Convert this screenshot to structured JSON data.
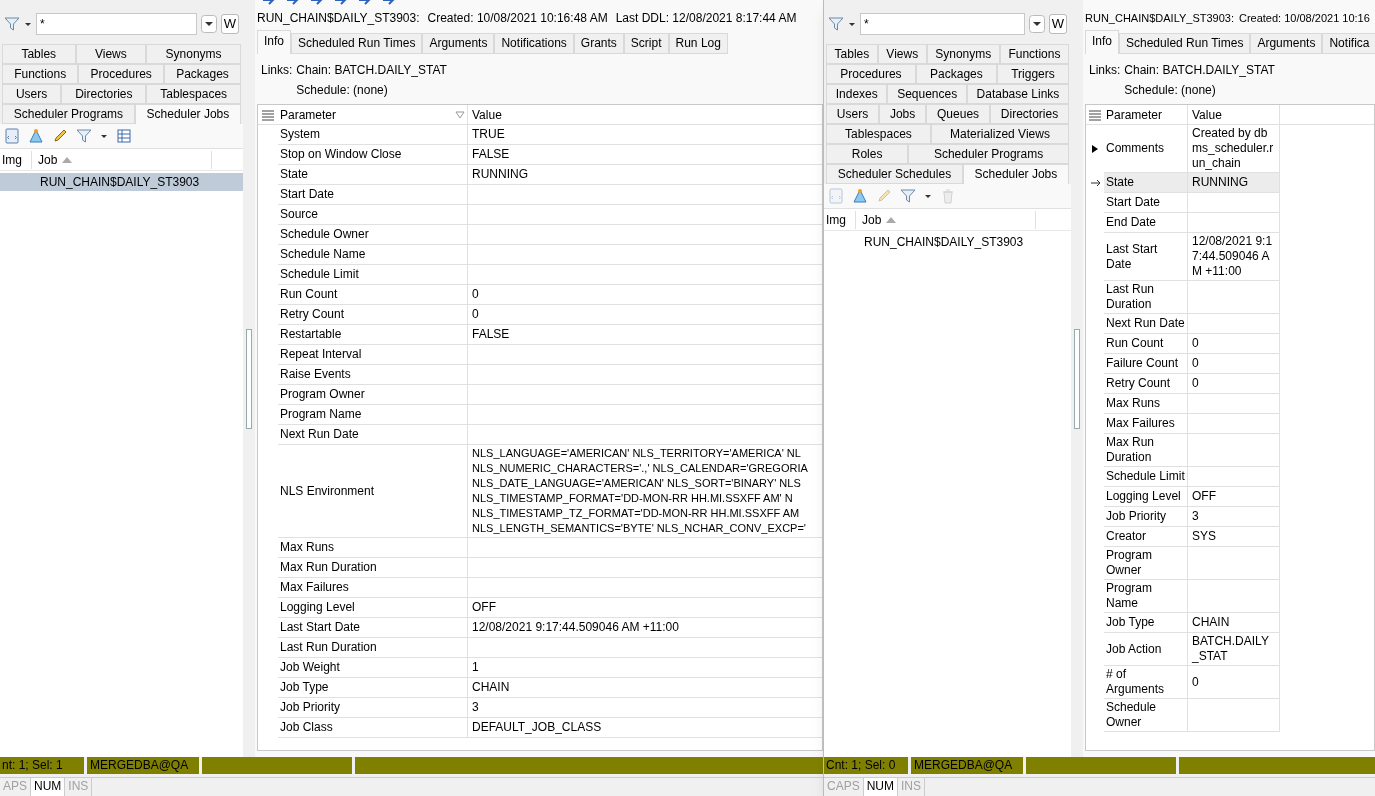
{
  "windows": [
    {
      "explorer": {
        "filter_value": "*",
        "w_button": "W",
        "tab_rows": [
          [
            {
              "label": "Tables",
              "selected": false
            },
            {
              "label": "Views",
              "selected": false
            },
            {
              "label": "Synonyms",
              "selected": false
            }
          ],
          [
            {
              "label": "Functions",
              "selected": false
            },
            {
              "label": "Procedures",
              "selected": false
            },
            {
              "label": "Packages",
              "selected": false
            }
          ],
          [
            {
              "label": "Users",
              "selected": false
            },
            {
              "label": "Directories",
              "selected": false
            },
            {
              "label": "Tablespaces",
              "selected": false
            }
          ],
          [
            {
              "label": "Scheduler Programs",
              "selected": false
            },
            {
              "label": "Scheduler Jobs",
              "selected": true
            }
          ]
        ],
        "toolbar": [
          {
            "kind": "script",
            "disabled": false
          },
          {
            "kind": "cone",
            "disabled": false
          },
          {
            "kind": "pencil",
            "disabled": false
          },
          {
            "kind": "filter",
            "disabled": false
          },
          {
            "kind": "grid",
            "disabled": false
          }
        ],
        "columns": [
          "Img",
          "Job"
        ],
        "rows": [
          {
            "job": "RUN_CHAIN$DAILY_ST3903",
            "selected": true
          }
        ]
      },
      "detail": {
        "object_name": "RUN_CHAIN$DAILY_ST3903:",
        "created": "Created: 10/08/2021 10:16:48 AM",
        "last_ddl": "Last DDL: 12/08/2021 8:17:44 AM",
        "tabs": [
          {
            "label": "Info",
            "selected": true
          },
          {
            "label": "Scheduled Run Times",
            "selected": false
          },
          {
            "label": "Arguments",
            "selected": false
          },
          {
            "label": "Notifications",
            "selected": false
          },
          {
            "label": "Grants",
            "selected": false
          },
          {
            "label": "Script",
            "selected": false
          },
          {
            "label": "Run Log",
            "selected": false
          }
        ],
        "links_label": "Links:",
        "links": [
          "Chain: BATCH.DAILY_STAT",
          "Schedule: (none)"
        ],
        "columns": [
          "Parameter",
          "Value"
        ],
        "rows": [
          {
            "parameter": "System",
            "value": "TRUE"
          },
          {
            "parameter": "Stop on Window Close",
            "value": "FALSE"
          },
          {
            "parameter": "State",
            "value": "RUNNING"
          },
          {
            "parameter": "Start Date"
          },
          {
            "parameter": "Source"
          },
          {
            "parameter": "Schedule Owner"
          },
          {
            "parameter": "Schedule Name"
          },
          {
            "parameter": "Schedule Limit"
          },
          {
            "parameter": "Run Count",
            "value": "0"
          },
          {
            "parameter": "Retry Count",
            "value": "0"
          },
          {
            "parameter": "Restartable",
            "value": "FALSE"
          },
          {
            "parameter": "Repeat Interval"
          },
          {
            "parameter": "Raise Events"
          },
          {
            "parameter": "Program Owner"
          },
          {
            "parameter": "Program Name"
          },
          {
            "parameter": "Next Run Date"
          },
          {
            "parameter": "NLS Environment",
            "value": "NLS_LANGUAGE='AMERICAN' NLS_TERRITORY='AMERICA' NL\nNLS_NUMERIC_CHARACTERS='.,' NLS_CALENDAR='GREGORIA\nNLS_DATE_LANGUAGE='AMERICAN' NLS_SORT='BINARY' NLS\nNLS_TIMESTAMP_FORMAT='DD-MON-RR HH.MI.SSXFF AM' N\nNLS_TIMESTAMP_TZ_FORMAT='DD-MON-RR HH.MI.SSXFF AM\nNLS_LENGTH_SEMANTICS='BYTE' NLS_NCHAR_CONV_EXCP='"
          },
          {
            "parameter": "Max Runs"
          },
          {
            "parameter": "Max Run Duration"
          },
          {
            "parameter": "Max Failures"
          },
          {
            "parameter": "Logging Level",
            "value": "OFF"
          },
          {
            "parameter": "Last Start Date",
            "value": "12/08/2021 9:17:44.509046 AM +11:00"
          },
          {
            "parameter": "Last Run Duration"
          },
          {
            "parameter": "Job Weight",
            "value": "1"
          },
          {
            "parameter": "Job Type",
            "value": "CHAIN"
          },
          {
            "parameter": "Job Priority",
            "value": "3"
          },
          {
            "parameter": "Job Class",
            "value": "DEFAULT_JOB_CLASS"
          }
        ]
      },
      "status_bar": {
        "count": "nt: 1; Sel: 1",
        "connection": "MERGEDBA@QA"
      },
      "keys": [
        {
          "label": "APS",
          "on": false
        },
        {
          "label": "NUM",
          "on": true
        },
        {
          "label": "INS",
          "on": false
        }
      ]
    },
    {
      "explorer": {
        "filter_value": "*",
        "w_button": "W",
        "tab_rows": [
          [
            {
              "label": "Tables",
              "selected": false
            },
            {
              "label": "Views",
              "selected": false
            },
            {
              "label": "Synonyms",
              "selected": false
            },
            {
              "label": "Functions",
              "selected": false
            }
          ],
          [
            {
              "label": "Procedures",
              "selected": false
            },
            {
              "label": "Packages",
              "selected": false
            },
            {
              "label": "Triggers",
              "selected": false
            }
          ],
          [
            {
              "label": "Indexes",
              "selected": false
            },
            {
              "label": "Sequences",
              "selected": false
            },
            {
              "label": "Database Links",
              "selected": false
            }
          ],
          [
            {
              "label": "Users",
              "selected": false
            },
            {
              "label": "Jobs",
              "selected": false
            },
            {
              "label": "Queues",
              "selected": false
            },
            {
              "label": "Directories",
              "selected": false
            }
          ],
          [
            {
              "label": "Tablespaces",
              "selected": false
            },
            {
              "label": "Materialized Views",
              "selected": false
            }
          ],
          [
            {
              "label": "Roles",
              "selected": false
            },
            {
              "label": "Scheduler Programs",
              "selected": false
            }
          ],
          [
            {
              "label": "Scheduler Schedules",
              "selected": false
            },
            {
              "label": "Scheduler Jobs",
              "selected": true
            }
          ]
        ],
        "toolbar": [
          {
            "kind": "script",
            "disabled": true
          },
          {
            "kind": "cone",
            "disabled": false
          },
          {
            "kind": "pencil",
            "disabled": true
          },
          {
            "kind": "filter",
            "disabled": false
          },
          {
            "kind": "trash",
            "disabled": true
          }
        ],
        "columns": [
          "Img",
          "Job"
        ],
        "rows": [
          {
            "job": "RUN_CHAIN$DAILY_ST3903",
            "selected": false
          }
        ]
      },
      "detail": {
        "object_name": "RUN_CHAIN$DAILY_ST3903:",
        "created": "Created: 10/08/2021 10:16",
        "tabs": [
          {
            "label": "Info",
            "selected": true
          },
          {
            "label": "Scheduled Run Times",
            "selected": false
          },
          {
            "label": "Arguments",
            "selected": false
          },
          {
            "label": "Notifica",
            "selected": false
          }
        ],
        "links_label": "Links:",
        "links": [
          "Chain: BATCH.DAILY_STAT",
          "Schedule: (none)"
        ],
        "columns": [
          "Parameter",
          "Value"
        ],
        "rows": [
          {
            "kind": "group",
            "parameter": "Comments",
            "value": "Created by dbms_scheduler.run_chain",
            "selected": false
          },
          {
            "kind": "field",
            "parameter": "State",
            "value": "RUNNING",
            "selected": true
          },
          {
            "kind": "field",
            "parameter": "Start Date",
            "selected": false
          },
          {
            "kind": "field",
            "parameter": "End Date",
            "selected": false
          },
          {
            "kind": "field",
            "parameter": "Last Start Date",
            "value": "12/08/2021 9:17:44.509046 AM +11:00",
            "selected": false
          },
          {
            "kind": "field",
            "parameter": "Last Run Duration",
            "selected": false
          },
          {
            "kind": "field",
            "parameter": "Next Run Date",
            "selected": false
          },
          {
            "kind": "field",
            "parameter": "Run Count",
            "value": "0",
            "selected": false
          },
          {
            "kind": "field",
            "parameter": "Failure Count",
            "value": "0",
            "selected": false
          },
          {
            "kind": "field",
            "parameter": "Retry Count",
            "value": "0",
            "selected": false
          },
          {
            "kind": "field",
            "parameter": "Max Runs",
            "selected": false
          },
          {
            "kind": "field",
            "parameter": "Max Failures",
            "selected": false
          },
          {
            "kind": "field",
            "parameter": "Max Run Duration",
            "selected": false
          },
          {
            "kind": "field",
            "parameter": "Schedule Limit",
            "selected": false
          },
          {
            "kind": "field",
            "parameter": "Logging Level",
            "value": "OFF",
            "selected": false
          },
          {
            "kind": "field",
            "parameter": "Job Priority",
            "value": "3",
            "selected": false
          },
          {
            "kind": "field",
            "parameter": "Creator",
            "value": "SYS",
            "selected": false
          },
          {
            "kind": "field",
            "parameter": "Program Owner",
            "selected": false
          },
          {
            "kind": "field",
            "parameter": "Program Name",
            "selected": false
          },
          {
            "kind": "field",
            "parameter": "Job Type",
            "value": "CHAIN",
            "selected": false
          },
          {
            "kind": "field",
            "parameter": "Job Action",
            "value": "BATCH.DAILY_STAT",
            "selected": false
          },
          {
            "kind": "field",
            "parameter": "# of Arguments",
            "value": "0",
            "selected": false
          },
          {
            "kind": "field",
            "parameter": "Schedule Owner",
            "selected": false
          }
        ]
      },
      "status_bar": {
        "count": "Cnt: 1; Sel: 0",
        "connection": "MERGEDBA@QA"
      },
      "keys": [
        {
          "label": "CAPS",
          "on": false
        },
        {
          "label": "NUM",
          "on": true
        },
        {
          "label": "INS",
          "on": false
        }
      ]
    }
  ]
}
